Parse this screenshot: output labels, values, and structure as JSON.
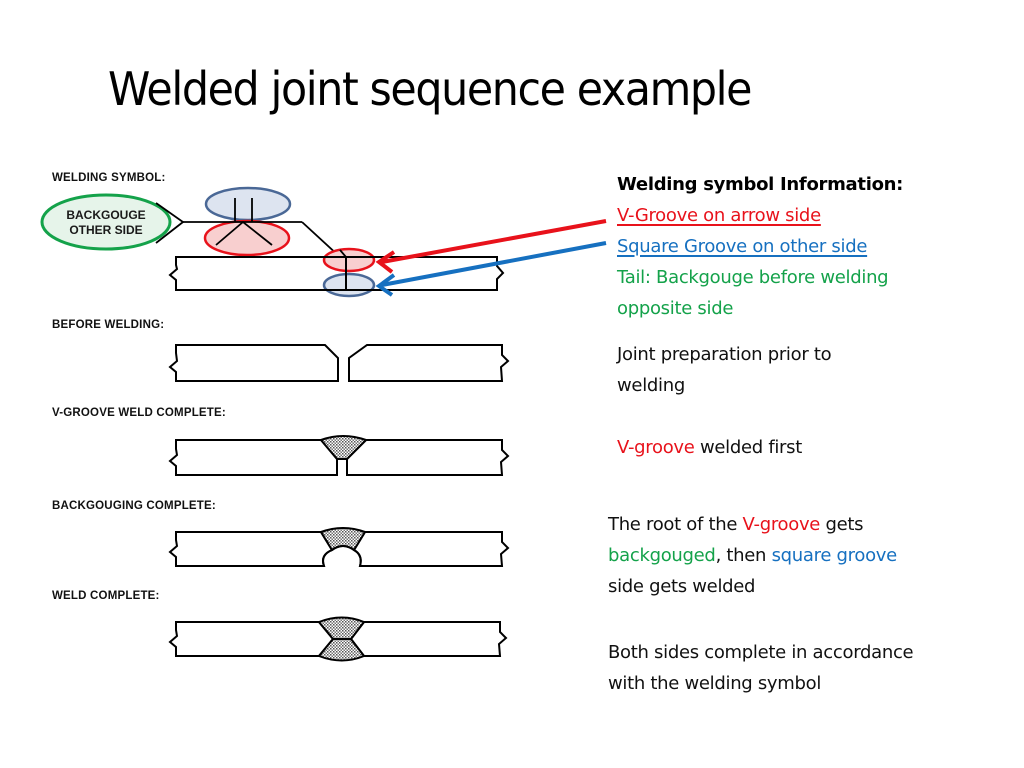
{
  "slide": {
    "title": "Welded joint sequence example"
  },
  "diagram": {
    "labels": {
      "welding_symbol": "WELDING SYMBOL:",
      "before_welding": "BEFORE WELDING:",
      "v_groove_complete": "V-GROOVE WELD COMPLETE:",
      "backgouging_complete": "BACKGOUGING COMPLETE:",
      "weld_complete": "WELD COMPLETE:"
    },
    "tail_line1": "BACKGOUGE",
    "tail_line2": "OTHER SIDE",
    "colors": {
      "red": "#e8121b",
      "blue": "#1670c0",
      "green": "#14a24a",
      "red_fill": "#f8cfcf",
      "blue_fill": "#dde4f0",
      "blue_stroke": "#4a6896",
      "green_fill": "#e6f4ea"
    }
  },
  "info": {
    "heading": "Welding symbol Information:",
    "arrow_side": "V-Groove on arrow side",
    "other_side": "Square Groove on other side",
    "tail_line1": "Tail: Backgouge before welding",
    "tail_line2": "opposite side"
  },
  "steps": {
    "prep_line1": "Joint preparation prior to",
    "prep_line2": "welding",
    "vgroove_word": "V-groove",
    "vgroove_rest": " welded first",
    "root_a": "The root of the ",
    "root_vgroove": "V-groove",
    "root_b": " gets",
    "root_backgouged": "backgouged",
    "root_c": ", then ",
    "root_square": "square groove",
    "root_line3": "side gets welded",
    "final_line1": "Both sides complete in accordance",
    "final_line2": "with the welding symbol"
  }
}
